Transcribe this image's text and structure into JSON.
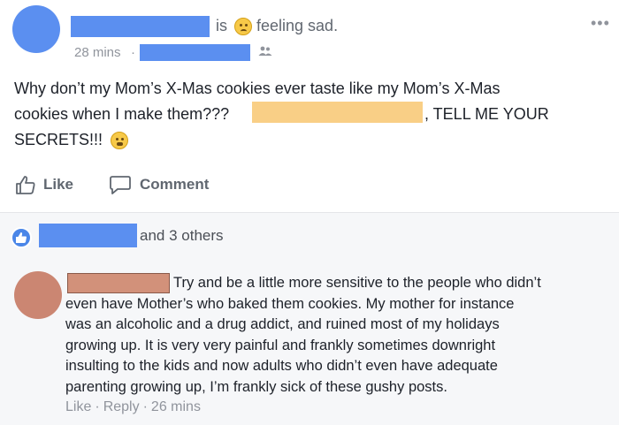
{
  "post": {
    "status_is": "is",
    "status_feeling": "feeling sad.",
    "time": "28 mins",
    "meta_separator": "·",
    "more_icon": "more-horizontal-icon",
    "body_line1": "Why don’t my Mom’s X-Mas cookies ever taste like my Mom’s X-Mas",
    "body_line2a": "cookies when I make them???",
    "body_line2b": ", TELL ME YOUR",
    "body_line3": "SECRETS!!!",
    "like_label": "Like",
    "comment_label": "Comment",
    "reactions_text": "and 3 others"
  },
  "comment": {
    "lines": [
      "Try and be a little more sensitive to the people who didn’t",
      "even have Mother’s who baked them cookies. My mother for instance",
      "was an alcoholic and a drug addict, and ruined most of my holidays",
      "growing up. It is very very painful and frankly sometimes downright",
      "insulting to the kids and now adults who didn’t even have adequate",
      "parenting growing up, I’m frankly sick of these gushy posts."
    ],
    "like_label": "Like",
    "reply_label": "Reply",
    "time": "26 mins",
    "separator": "·"
  },
  "colors": {
    "redaction_blue": "#5b8ff0",
    "redaction_orange": "#f9cf86",
    "redaction_brown": "#d2917a",
    "facebook_blue": "#4a86e8"
  }
}
